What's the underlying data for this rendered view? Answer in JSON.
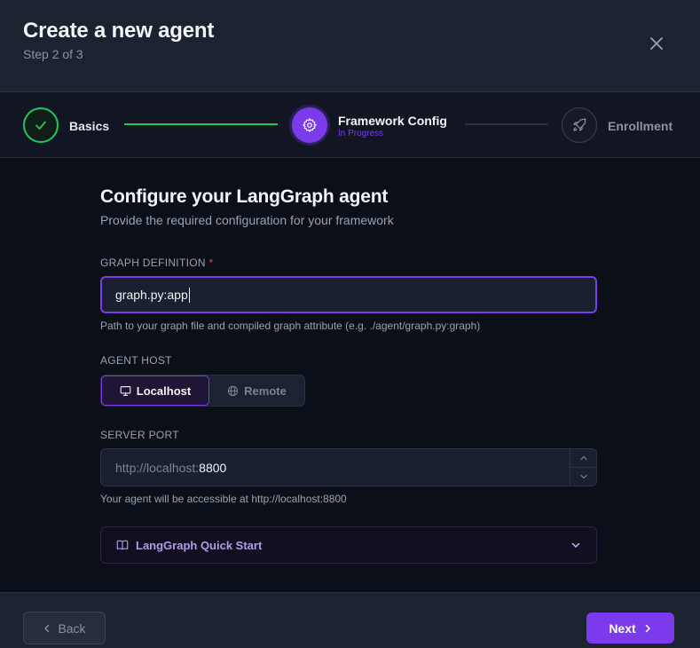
{
  "dialog": {
    "title": "Create a new agent",
    "subtitle": "Step 2 of 3"
  },
  "steps": [
    {
      "label": "Basics",
      "status": "complete",
      "icon": "check-icon"
    },
    {
      "label": "Framework Config",
      "status_text": "In Progress",
      "status": "active",
      "icon": "gear-icon"
    },
    {
      "label": "Enrollment",
      "status": "pending",
      "icon": "rocket-icon"
    }
  ],
  "form": {
    "title": "Configure your LangGraph agent",
    "subtitle": "Provide the required configuration for your framework",
    "graph_definition": {
      "label": "GRAPH DEFINITION",
      "required_mark": "*",
      "value": "graph.py:app",
      "help": "Path to your graph file and compiled graph attribute (e.g. ./agent/graph.py:graph)"
    },
    "agent_host": {
      "label": "AGENT HOST",
      "options": [
        {
          "label": "Localhost",
          "icon": "monitor-icon",
          "selected": true
        },
        {
          "label": "Remote",
          "icon": "globe-icon",
          "selected": false
        }
      ]
    },
    "server_port": {
      "label": "SERVER PORT",
      "prefix": "http://localhost:",
      "value": "8800",
      "help": "Your agent will be accessible at http://localhost:8800"
    },
    "quick_start": {
      "label": "LangGraph Quick Start",
      "icon": "book-icon"
    }
  },
  "footer": {
    "back_label": "Back",
    "next_label": "Next"
  },
  "colors": {
    "accent": "#7c3aed",
    "success": "#22c55e",
    "required": "#ef4444"
  }
}
